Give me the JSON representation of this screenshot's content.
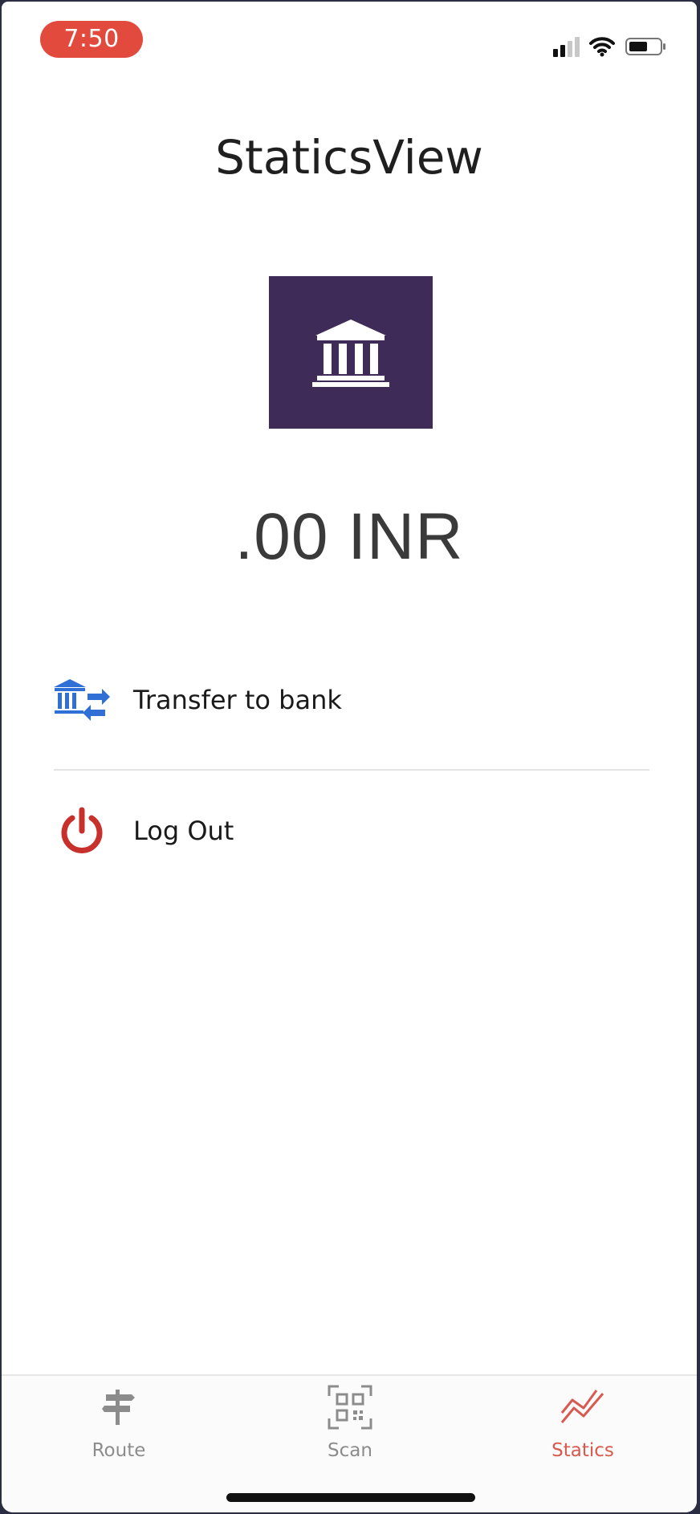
{
  "status_bar": {
    "time": "7:50",
    "signal_icon": "cellular-signal-icon",
    "wifi_icon": "wifi-icon",
    "battery_icon": "battery-icon"
  },
  "header": {
    "title": "StaticsView"
  },
  "bank_tile": {
    "icon": "bank-building-icon",
    "color": "#3e2b57"
  },
  "balance": {
    "amount_text": ".00 INR"
  },
  "menu": {
    "transfer": {
      "label": "Transfer to bank",
      "icon": "bank-transfer-icon",
      "color": "#2f6fd6"
    },
    "logout": {
      "label": "Log Out",
      "icon": "power-icon",
      "color": "#c8302b"
    }
  },
  "tabbar": {
    "active_color": "#d85a4f",
    "inactive_color": "#8c8c8c",
    "tabs": [
      {
        "label": "Route",
        "icon": "signpost-icon"
      },
      {
        "label": "Scan",
        "icon": "qr-scan-icon"
      },
      {
        "label": "Statics",
        "icon": "trend-chart-icon",
        "active": true
      }
    ]
  }
}
